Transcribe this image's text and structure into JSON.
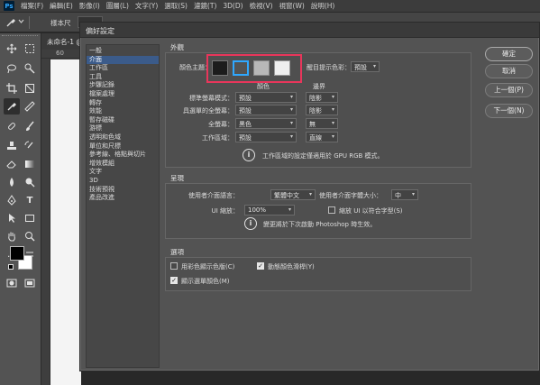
{
  "menubar": {
    "logo": "Ps",
    "items": [
      "檔案(F)",
      "編輯(E)",
      "影像(I)",
      "圖層(L)",
      "文字(Y)",
      "選取(S)",
      "濾鏡(T)",
      "3D(D)",
      "檢視(V)",
      "視窗(W)",
      "說明(H)"
    ]
  },
  "optionsbar": {
    "tool_label": "樣本尺"
  },
  "document": {
    "tab_label": "未命名-1 @"
  },
  "dialog": {
    "title": "偏好設定",
    "categories": [
      "一般",
      "介面",
      "工作區",
      "工具",
      "步驟記錄",
      "檔案處理",
      "轉存",
      "效能",
      "暫存磁碟",
      "游標",
      "透明和色域",
      "單位和尺標",
      "參考線、格點與切片",
      "增效模組",
      "文字",
      "3D",
      "技術預視",
      "產品改進"
    ],
    "selected_category_index": 1,
    "buttons": {
      "ok": "確定",
      "cancel": "取消",
      "prev": "上一個(P)",
      "next": "下一個(N)"
    },
    "appearance": {
      "title": "外觀",
      "color_theme_label": "顏色主題：",
      "theme_swatches": [
        "#1c1c1c",
        "#535353",
        "#b8b8b8",
        "#efefef"
      ],
      "selected_theme_index": 1,
      "highlight_label_label": "醒目提示色彩：",
      "highlight_color_value": "預設",
      "col_color": "顏色",
      "col_border": "邊界",
      "rows": [
        {
          "label": "標準螢幕模式：",
          "color": "預設",
          "border": "陰影"
        },
        {
          "label": "具選單的全螢幕：",
          "color": "預設",
          "border": "陰影"
        },
        {
          "label": "全螢幕：",
          "color": "黑色",
          "border": "無"
        },
        {
          "label": "工作區域：",
          "color": "預設",
          "border": "直線"
        }
      ],
      "info_text": "工作區域的設定僅適用於 GPU RGB 模式。"
    },
    "presentation": {
      "title": "呈現",
      "ui_language_label": "使用者介面語言：",
      "ui_language_value": "繁體中文",
      "ui_font_size_label": "使用者介面字體大小：",
      "ui_font_size_value": "中",
      "ui_scaling_label": "UI 縮放：",
      "ui_scaling_value": "100%",
      "scale_ui_font_label": "縮放 UI 以符合字型(S)",
      "scale_ui_font_checked": false,
      "info_text": "變更將於下次啟動 Photoshop 時生效。"
    },
    "options": {
      "title": "選項",
      "color_channels_label": "用彩色顯示色版(C)",
      "color_channels_checked": false,
      "dynamic_sliders_label": "動態顏色滑桿(Y)",
      "dynamic_sliders_checked": true,
      "menu_colors_label": "顯示選單顏色(M)",
      "menu_colors_checked": true
    }
  },
  "colors": {
    "highlight_outline": "#e8365b",
    "selected_category_bg": "#3b5b8a",
    "selected_swatch_border": "#2fa8ff",
    "canvas": "#f4f4f4"
  },
  "icons": [
    "photoshop-logo",
    "eyedropper-icon",
    "chevron-down-icon",
    "move-icon",
    "marquee-icon",
    "lasso-icon",
    "crop-icon",
    "eyedropper-tool-icon",
    "brush-icon",
    "stamp-icon",
    "eraser-icon",
    "gradient-icon",
    "blur-icon",
    "dodge-icon",
    "pen-icon",
    "type-icon",
    "path-selection-icon",
    "shape-icon",
    "hand-icon",
    "zoom-icon",
    "info-icon"
  ]
}
